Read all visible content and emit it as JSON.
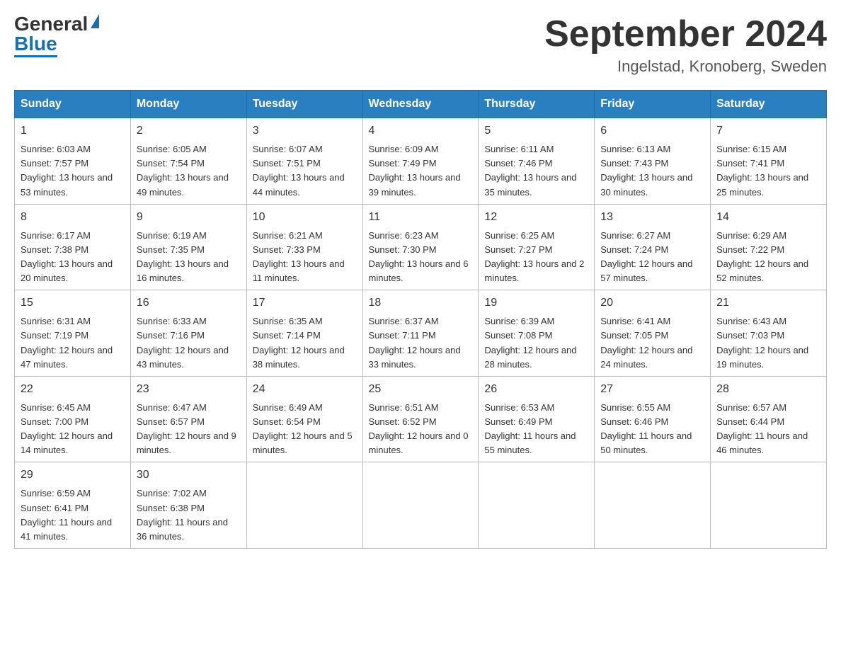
{
  "logo": {
    "general": "General",
    "blue": "Blue"
  },
  "title": "September 2024",
  "subtitle": "Ingelstad, Kronoberg, Sweden",
  "days_of_week": [
    "Sunday",
    "Monday",
    "Tuesday",
    "Wednesday",
    "Thursday",
    "Friday",
    "Saturday"
  ],
  "weeks": [
    [
      {
        "day": "1",
        "sunrise": "6:03 AM",
        "sunset": "7:57 PM",
        "daylight": "13 hours and 53 minutes."
      },
      {
        "day": "2",
        "sunrise": "6:05 AM",
        "sunset": "7:54 PM",
        "daylight": "13 hours and 49 minutes."
      },
      {
        "day": "3",
        "sunrise": "6:07 AM",
        "sunset": "7:51 PM",
        "daylight": "13 hours and 44 minutes."
      },
      {
        "day": "4",
        "sunrise": "6:09 AM",
        "sunset": "7:49 PM",
        "daylight": "13 hours and 39 minutes."
      },
      {
        "day": "5",
        "sunrise": "6:11 AM",
        "sunset": "7:46 PM",
        "daylight": "13 hours and 35 minutes."
      },
      {
        "day": "6",
        "sunrise": "6:13 AM",
        "sunset": "7:43 PM",
        "daylight": "13 hours and 30 minutes."
      },
      {
        "day": "7",
        "sunrise": "6:15 AM",
        "sunset": "7:41 PM",
        "daylight": "13 hours and 25 minutes."
      }
    ],
    [
      {
        "day": "8",
        "sunrise": "6:17 AM",
        "sunset": "7:38 PM",
        "daylight": "13 hours and 20 minutes."
      },
      {
        "day": "9",
        "sunrise": "6:19 AM",
        "sunset": "7:35 PM",
        "daylight": "13 hours and 16 minutes."
      },
      {
        "day": "10",
        "sunrise": "6:21 AM",
        "sunset": "7:33 PM",
        "daylight": "13 hours and 11 minutes."
      },
      {
        "day": "11",
        "sunrise": "6:23 AM",
        "sunset": "7:30 PM",
        "daylight": "13 hours and 6 minutes."
      },
      {
        "day": "12",
        "sunrise": "6:25 AM",
        "sunset": "7:27 PM",
        "daylight": "13 hours and 2 minutes."
      },
      {
        "day": "13",
        "sunrise": "6:27 AM",
        "sunset": "7:24 PM",
        "daylight": "12 hours and 57 minutes."
      },
      {
        "day": "14",
        "sunrise": "6:29 AM",
        "sunset": "7:22 PM",
        "daylight": "12 hours and 52 minutes."
      }
    ],
    [
      {
        "day": "15",
        "sunrise": "6:31 AM",
        "sunset": "7:19 PM",
        "daylight": "12 hours and 47 minutes."
      },
      {
        "day": "16",
        "sunrise": "6:33 AM",
        "sunset": "7:16 PM",
        "daylight": "12 hours and 43 minutes."
      },
      {
        "day": "17",
        "sunrise": "6:35 AM",
        "sunset": "7:14 PM",
        "daylight": "12 hours and 38 minutes."
      },
      {
        "day": "18",
        "sunrise": "6:37 AM",
        "sunset": "7:11 PM",
        "daylight": "12 hours and 33 minutes."
      },
      {
        "day": "19",
        "sunrise": "6:39 AM",
        "sunset": "7:08 PM",
        "daylight": "12 hours and 28 minutes."
      },
      {
        "day": "20",
        "sunrise": "6:41 AM",
        "sunset": "7:05 PM",
        "daylight": "12 hours and 24 minutes."
      },
      {
        "day": "21",
        "sunrise": "6:43 AM",
        "sunset": "7:03 PM",
        "daylight": "12 hours and 19 minutes."
      }
    ],
    [
      {
        "day": "22",
        "sunrise": "6:45 AM",
        "sunset": "7:00 PM",
        "daylight": "12 hours and 14 minutes."
      },
      {
        "day": "23",
        "sunrise": "6:47 AM",
        "sunset": "6:57 PM",
        "daylight": "12 hours and 9 minutes."
      },
      {
        "day": "24",
        "sunrise": "6:49 AM",
        "sunset": "6:54 PM",
        "daylight": "12 hours and 5 minutes."
      },
      {
        "day": "25",
        "sunrise": "6:51 AM",
        "sunset": "6:52 PM",
        "daylight": "12 hours and 0 minutes."
      },
      {
        "day": "26",
        "sunrise": "6:53 AM",
        "sunset": "6:49 PM",
        "daylight": "11 hours and 55 minutes."
      },
      {
        "day": "27",
        "sunrise": "6:55 AM",
        "sunset": "6:46 PM",
        "daylight": "11 hours and 50 minutes."
      },
      {
        "day": "28",
        "sunrise": "6:57 AM",
        "sunset": "6:44 PM",
        "daylight": "11 hours and 46 minutes."
      }
    ],
    [
      {
        "day": "29",
        "sunrise": "6:59 AM",
        "sunset": "6:41 PM",
        "daylight": "11 hours and 41 minutes."
      },
      {
        "day": "30",
        "sunrise": "7:02 AM",
        "sunset": "6:38 PM",
        "daylight": "11 hours and 36 minutes."
      },
      null,
      null,
      null,
      null,
      null
    ]
  ],
  "labels": {
    "sunrise": "Sunrise:",
    "sunset": "Sunset:",
    "daylight": "Daylight:"
  }
}
